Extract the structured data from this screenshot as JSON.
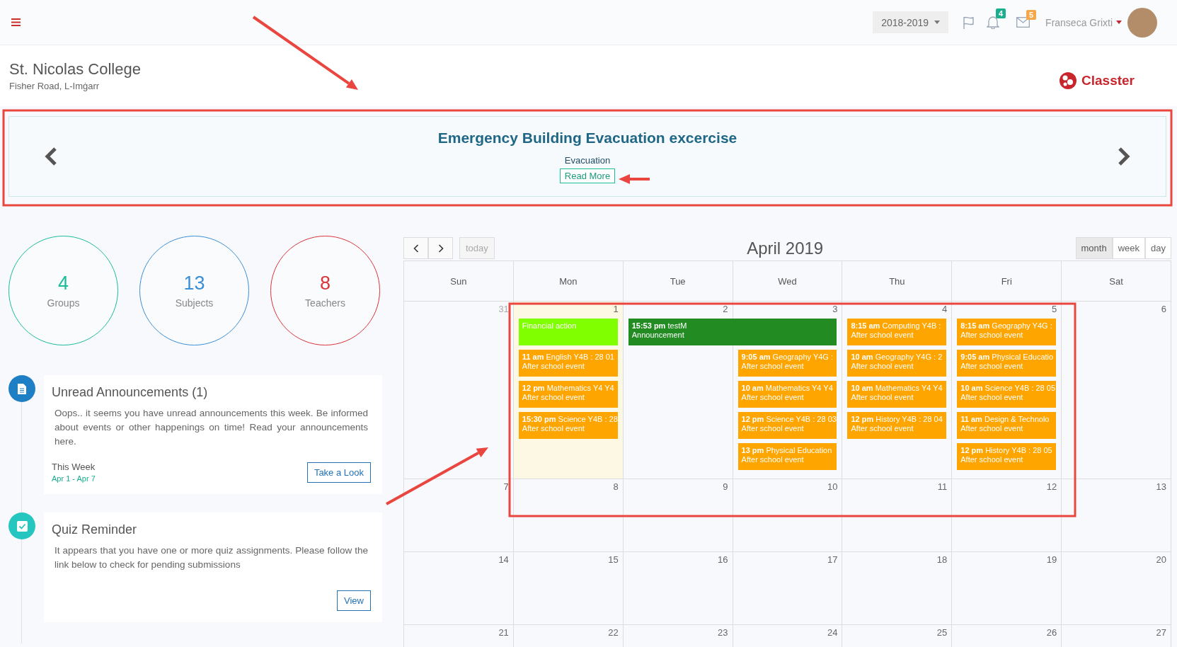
{
  "top_bar": {
    "school_year": "2018-2019",
    "notifications_badge": "4",
    "messages_badge": "5",
    "user_name": "Franseca Grixti"
  },
  "header": {
    "school_name": "St. Nicolas College",
    "address": "Fisher Road, L-Imġarr",
    "logo_text": "Classter"
  },
  "banner": {
    "title": "Emergency Building Evacuation excercise",
    "subtitle": "Evacuation",
    "button": "Read More"
  },
  "stats": [
    {
      "value": "4",
      "label": "Groups",
      "color": "#1abc9c"
    },
    {
      "value": "13",
      "label": "Subjects",
      "color": "#3a8fd6"
    },
    {
      "value": "8",
      "label": "Teachers",
      "color": "#d9343a"
    }
  ],
  "timeline": [
    {
      "kind": "document",
      "color": "#1f7fc4",
      "title": "Unread Announcements (1)",
      "body": "Oops.. it seems you have unread announcements this week. Be informed about events or other happenings on time! Read your announcements here.",
      "period_label": "This Week",
      "period_dates": "Apr 1 - Apr 7",
      "button": "Take a Look"
    },
    {
      "kind": "check",
      "color": "#26c6c0",
      "title": "Quiz Reminder",
      "body": "It appears that you have one or more quiz assignments. Please follow the link below to check for pending submissions",
      "button": "View"
    }
  ],
  "calendar": {
    "title": "April 2019",
    "today_button": {
      "label": "today",
      "disabled": true
    },
    "views": [
      {
        "label": "month",
        "selected": true
      },
      {
        "label": "week",
        "selected": false
      },
      {
        "label": "day",
        "selected": false
      }
    ],
    "weekdays": [
      "Sun",
      "Mon",
      "Tue",
      "Wed",
      "Thu",
      "Fri",
      "Sat"
    ],
    "weeks": [
      {
        "days": [
          {
            "date": "31",
            "other_month": true,
            "today": false
          },
          {
            "date": "1",
            "other_month": false,
            "today": true,
            "events": [
              {
                "title": "Financial action",
                "color": "#80ff00",
                "continues_next_day": false
              },
              {
                "title": "**11 am** English Y4B : 28 01",
                "subtitle": "After school event",
                "color": "#ffa500",
                "continues_next_day": false
              },
              {
                "title": "**12 pm** Mathematics Y4 Y4",
                "subtitle": "After school event",
                "color": "#ffa500",
                "continues_next_day": false
              },
              {
                "title": "**15:30 pm** Science Y4B : 28",
                "subtitle": "After school event",
                "color": "#ffa500",
                "continues_next_day": false
              }
            ]
          },
          {
            "date": "2",
            "other_month": false,
            "today": false,
            "events": [
              {
                "title": "**15:53 pm** testM",
                "subtitle": "Announcement",
                "color": "#228b22",
                "continues_next_day": true
              }
            ]
          },
          {
            "date": "3",
            "other_month": false,
            "today": false,
            "events": [
              {
                "title": "**9:05 am** Geography Y4G :",
                "subtitle": "After school event",
                "color": "#ffa500",
                "continues_next_day": false
              },
              {
                "title": "**10 am** Mathematics Y4 Y4",
                "subtitle": "After school event",
                "color": "#ffa500",
                "continues_next_day": false
              },
              {
                "title": "**12 pm** Science Y4B : 28 03",
                "subtitle": "After school event",
                "color": "#ffa500",
                "continues_next_day": false
              },
              {
                "title": "**13 pm** Physical Education",
                "subtitle": "After school event",
                "color": "#ffa500",
                "continues_next_day": false
              }
            ]
          },
          {
            "date": "4",
            "other_month": false,
            "today": false,
            "events": [
              {
                "title": "**8:15 am** Computing Y4B :",
                "subtitle": "After school event",
                "color": "#ffa500",
                "continues_next_day": false
              },
              {
                "title": "**10 am** Geography Y4G : 2",
                "subtitle": "After school event",
                "color": "#ffa500",
                "continues_next_day": false
              },
              {
                "title": "**10 am** Mathematics Y4 Y4",
                "subtitle": "After school event",
                "color": "#ffa500",
                "continues_next_day": false
              },
              {
                "title": "**12 pm** History Y4B : 28 04",
                "subtitle": "After school event",
                "color": "#ffa500",
                "continues_next_day": false
              }
            ]
          },
          {
            "date": "5",
            "other_month": false,
            "today": false,
            "events": [
              {
                "title": "**8:15 am** Geography Y4G :",
                "subtitle": "After school event",
                "color": "#ffa500",
                "continues_next_day": false
              },
              {
                "title": "**9:05 am** Physical Educatio",
                "subtitle": "After school event",
                "color": "#ffa500",
                "continues_next_day": false
              },
              {
                "title": "**10 am** Science Y4B : 28 05",
                "subtitle": "After school event",
                "color": "#ffa500",
                "continues_next_day": false
              },
              {
                "title": "**11 am** Design & Technolo",
                "subtitle": "After school event",
                "color": "#ffa500",
                "continues_next_day": false
              },
              {
                "title": "**12 pm** History Y4B : 28 05",
                "subtitle": "After school event",
                "color": "#ffa500",
                "continues_next_day": false
              }
            ]
          },
          {
            "date": "6",
            "other_month": false,
            "today": false
          }
        ]
      },
      {
        "days": [
          {
            "date": "7",
            "other_month": false,
            "today": false
          },
          {
            "date": "8",
            "other_month": false,
            "today": false
          },
          {
            "date": "9",
            "other_month": false,
            "today": false
          },
          {
            "date": "10",
            "other_month": false,
            "today": false
          },
          {
            "date": "11",
            "other_month": false,
            "today": false
          },
          {
            "date": "12",
            "other_month": false,
            "today": false
          },
          {
            "date": "13",
            "other_month": false,
            "today": false
          }
        ]
      },
      {
        "days": [
          {
            "date": "14",
            "other_month": false,
            "today": false
          },
          {
            "date": "15",
            "other_month": false,
            "today": false
          },
          {
            "date": "16",
            "other_month": false,
            "today": false
          },
          {
            "date": "17",
            "other_month": false,
            "today": false
          },
          {
            "date": "18",
            "other_month": false,
            "today": false
          },
          {
            "date": "19",
            "other_month": false,
            "today": false
          },
          {
            "date": "20",
            "other_month": false,
            "today": false
          }
        ]
      },
      {
        "days": [
          {
            "date": "21",
            "other_month": false,
            "today": false
          },
          {
            "date": "22",
            "other_month": false,
            "today": false
          },
          {
            "date": "23",
            "other_month": false,
            "today": false
          },
          {
            "date": "24",
            "other_month": false,
            "today": false
          },
          {
            "date": "25",
            "other_month": false,
            "today": false
          },
          {
            "date": "26",
            "other_month": false,
            "today": false
          },
          {
            "date": "27",
            "other_month": false,
            "today": false
          }
        ]
      }
    ]
  }
}
